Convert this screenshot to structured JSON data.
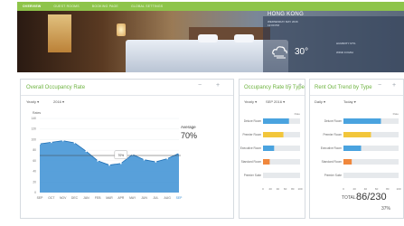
{
  "nav": {
    "tabs": [
      "OVERVIEW",
      "GUEST ROOMS",
      "BOOKING PAGE",
      "GLOBAL SETTINGS"
    ]
  },
  "hero": {
    "city": "HONG KONG",
    "line1": "WEDNESDAY MAY 2016",
    "line2": "12:00 PM",
    "temp": "30°",
    "wx1": "HUMIDITY 67%",
    "wx2": "WIND 9 KM/H"
  },
  "occupancy": {
    "title": "Overall Occupancy Rate",
    "period": "Yearly",
    "year": "2016",
    "average_label": "Average",
    "average_value": "70%",
    "tooltip": "70%",
    "chart_data": {
      "type": "area",
      "categories": [
        "SEP",
        "OCT",
        "NOV",
        "DEC",
        "JAN",
        "FEB",
        "MAR",
        "APR",
        "MAY",
        "JUN",
        "JUL",
        "AUG",
        "SEP"
      ],
      "values": [
        92,
        95,
        98,
        94,
        78,
        60,
        52,
        55,
        72,
        62,
        58,
        64,
        74
      ],
      "average": 70,
      "ylabel": "Rates",
      "yticks": [
        "140",
        "120",
        "100",
        "80",
        "60",
        "40",
        "20",
        "0"
      ],
      "ylim": [
        0,
        140
      ]
    }
  },
  "rate_by_type": {
    "title": "Occupancy Rate by Type",
    "period": "Yearly",
    "month": "SEP 2016",
    "header": "Rate",
    "chart_data": {
      "type": "bar",
      "categories": [
        "Deluxe Room",
        "Premier Room",
        "Executive Room",
        "Standard Room",
        "Premier Suite"
      ],
      "values": [
        70,
        55,
        30,
        18,
        8
      ],
      "colors": [
        "#4aa3df",
        "#f2c63b",
        "#4aa3df",
        "#f0873c",
        "#e6e9ec"
      ],
      "xticks": [
        "0",
        "20",
        "40",
        "60",
        "80",
        "100"
      ],
      "xlim": [
        0,
        100
      ]
    }
  },
  "rent_out": {
    "title": "Rent Out Trend by Type",
    "period": "Daily",
    "day": "Today",
    "header": "Rate",
    "total_label": "TOTAL",
    "total_value": "86/230",
    "total_pct": "37%",
    "chart_data": {
      "type": "bar",
      "categories": [
        "Deluxe Room",
        "Premier Room",
        "Executive Room",
        "Standard Room",
        "Premier Suite"
      ],
      "values": [
        68,
        50,
        32,
        15,
        0
      ],
      "colors": [
        "#4aa3df",
        "#f2c63b",
        "#4aa3df",
        "#f0873c",
        "#e6e9ec"
      ],
      "xticks": [
        "0",
        "20",
        "40",
        "60",
        "80",
        "100"
      ],
      "xlim": [
        0,
        100
      ]
    }
  },
  "colors": {
    "accent": "#6db33f",
    "nav": "#8ec44a",
    "area": "#3b8fd4"
  },
  "icons": {
    "minimize": "minus-icon",
    "expand": "plus-icon",
    "weather": "cloud-wind-icon"
  }
}
